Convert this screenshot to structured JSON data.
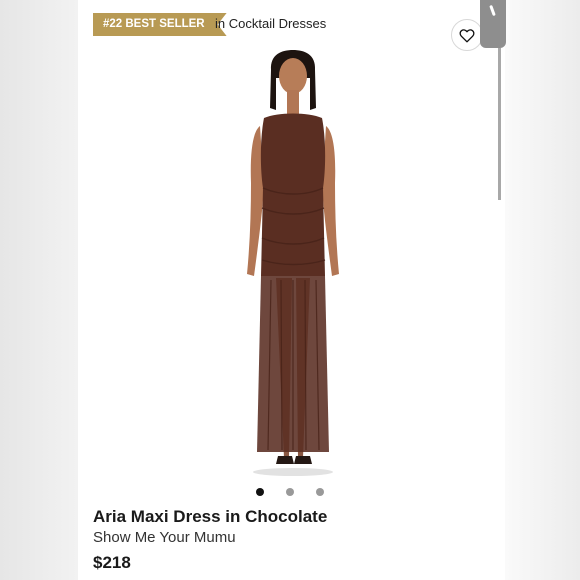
{
  "badge": {
    "label": "#22 BEST SELLER",
    "context": "in Cocktail Dresses",
    "color": "#b89a54"
  },
  "actions": {
    "favorite_icon": "heart-outline-icon"
  },
  "gallery": {
    "image_alt": "Aria Maxi Dress in Chocolate",
    "dress_color": "#5a2e22",
    "dots_total": 3,
    "active_index": 0
  },
  "product": {
    "title": "Aria Maxi Dress in Chocolate",
    "brand": "Show Me Your Mumu",
    "price": "$218"
  }
}
